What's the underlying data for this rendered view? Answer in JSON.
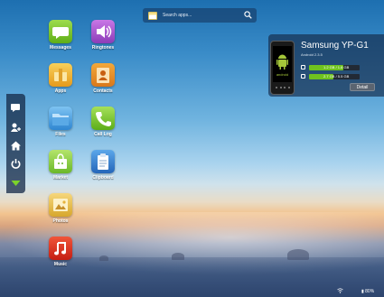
{
  "search": {
    "placeholder": "Search apps..."
  },
  "apps": [
    {
      "label": "Messages",
      "icon": "messages-icon"
    },
    {
      "label": "Ringtones",
      "icon": "ringtones-icon"
    },
    {
      "label": "Apps",
      "icon": "apps-icon"
    },
    {
      "label": "Contacts",
      "icon": "contacts-icon"
    },
    {
      "label": "Files",
      "icon": "files-icon"
    },
    {
      "label": "Call Log",
      "icon": "call-log-icon"
    },
    {
      "label": "Market",
      "icon": "market-icon"
    },
    {
      "label": "Clipboard",
      "icon": "clipboard-icon"
    },
    {
      "label": "Photos",
      "icon": "photos-icon"
    },
    {
      "label": "Music",
      "icon": "music-icon"
    }
  ],
  "sidebar": {
    "items": [
      {
        "icon": "chat-icon"
      },
      {
        "icon": "user-add-icon"
      },
      {
        "icon": "home-icon"
      },
      {
        "icon": "power-icon"
      },
      {
        "icon": "collapse-arrow-icon"
      }
    ]
  },
  "device": {
    "name": "Samsung YP-G1",
    "os": "Android 2.3.5",
    "phone_brand": "android",
    "storage": [
      {
        "text": "1.2 GB / 1.8 GB",
        "fraction": 0.67
      },
      {
        "text": "2.7 GB / 5.5 GB",
        "fraction": 0.49
      }
    ],
    "detail_label": "Detail"
  },
  "tray": {
    "battery": "80%"
  },
  "colors": {
    "accent_green": "#6fc21f",
    "panel_bg": "#14284680"
  }
}
